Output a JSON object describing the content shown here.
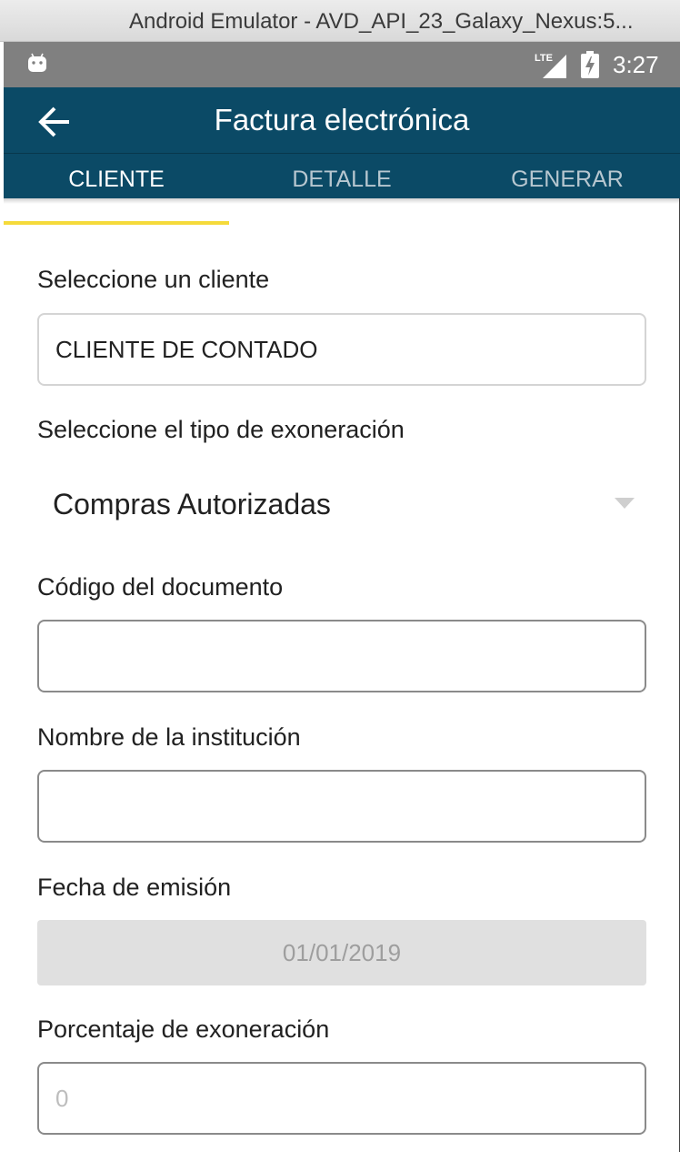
{
  "window": {
    "title": "Android Emulator - AVD_API_23_Galaxy_Nexus:5..."
  },
  "statusbar": {
    "time": "3:27",
    "network": "LTE",
    "icons": [
      "android-icon",
      "lte-signal-icon",
      "battery-charging-icon"
    ]
  },
  "appbar": {
    "title": "Factura electrónica",
    "back_icon": "arrow-back-icon",
    "tabs": [
      {
        "label": "CLIENTE",
        "active": true
      },
      {
        "label": "DETALLE",
        "active": false
      },
      {
        "label": "GENERAR",
        "active": false
      }
    ],
    "tab_indicator_color": "#f5da3a",
    "background_color": "#0b4a66"
  },
  "form": {
    "cliente": {
      "label": "Seleccione un cliente",
      "value": "CLIENTE DE CONTADO"
    },
    "exoneracion": {
      "label": "Seleccione el tipo de exoneración",
      "value": "Compras Autorizadas"
    },
    "codigo": {
      "label": "Código del documento",
      "value": ""
    },
    "institucion": {
      "label": "Nombre de la institución",
      "value": ""
    },
    "fecha": {
      "label": "Fecha de emisión",
      "value": "01/01/2019"
    },
    "porcentaje": {
      "label": "Porcentaje de exoneración",
      "value": "",
      "placeholder": "0"
    }
  }
}
